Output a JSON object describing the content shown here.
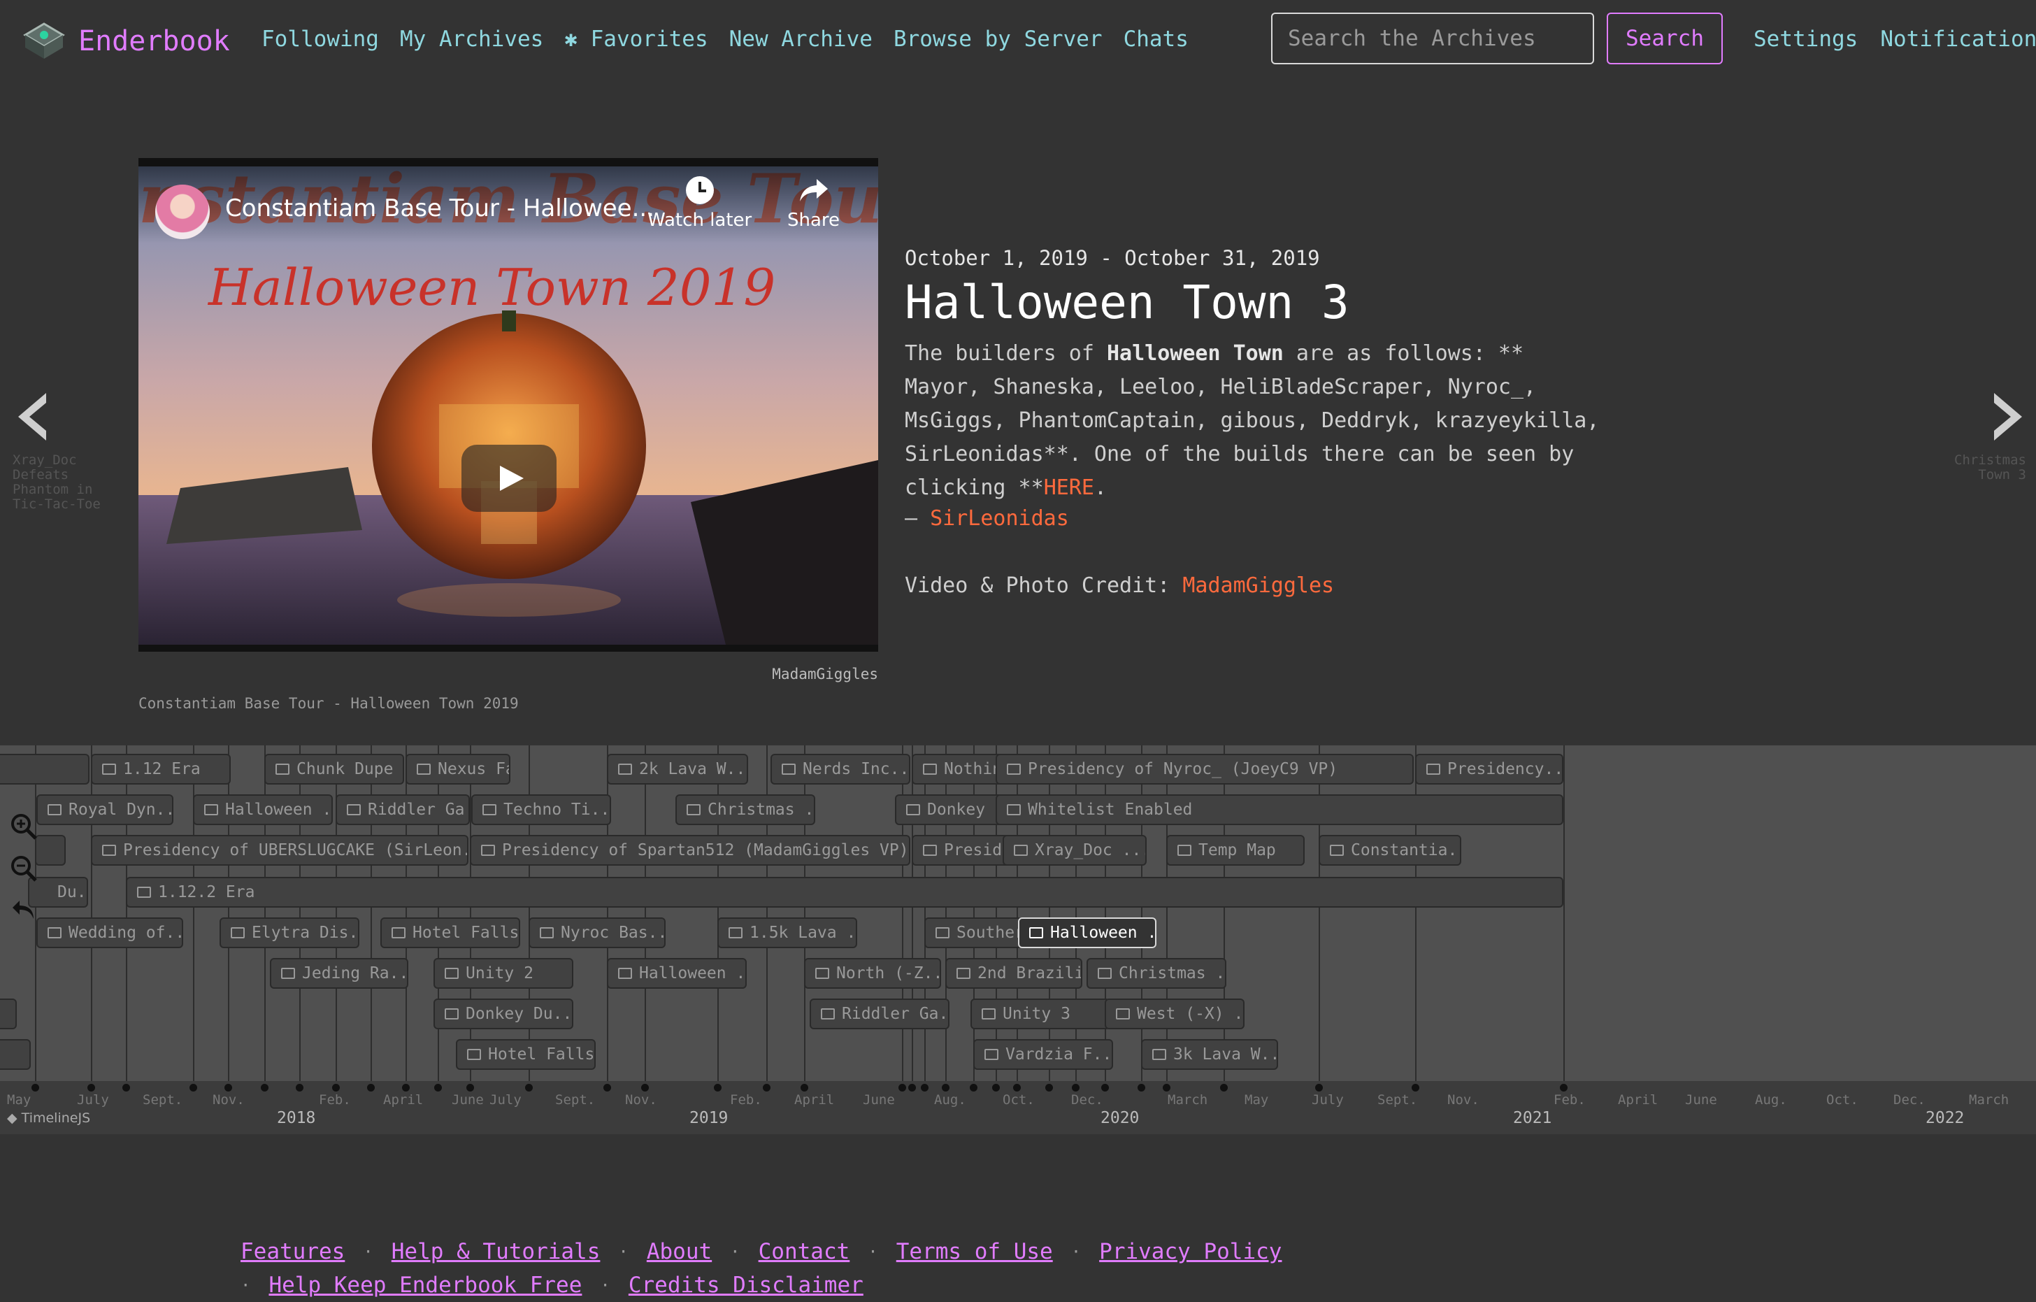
{
  "header": {
    "brand": "Enderbook",
    "nav": [
      "Following",
      "My Archives",
      "Favorites",
      "New Archive",
      "Browse by Server",
      "Chats"
    ],
    "search_placeholder": "Search the Archives",
    "search_button": "Search",
    "settings": "Settings",
    "notifications": "Notifications"
  },
  "slide": {
    "video_title": "Constantiam Base Tour - Hallowee...",
    "watch_later": "Watch later",
    "share": "Share",
    "video_credit": "MadamGiggles",
    "caption": "Constantiam Base Tour - Halloween Town 2019",
    "date": "October 1, 2019 - October 31, 2019",
    "title": "Halloween Town 3",
    "body_1": "The builders of ",
    "body_bold": "Halloween Town",
    "body_2": " are as follows: ** Mayor, Shaneska, Leeloo, HeliBladeScraper, Nyroc_, MsGiggs, PhantomCaptain, gibous, Deddryk, krazyeykilla, SirLeonidas**. One of the builds there can be seen by clicking **",
    "body_link": "HERE",
    "body_end": ".",
    "quote_dash": "— ",
    "quote_author": "SirLeonidas",
    "credit_label": "Video & Photo Credit: ",
    "credit_name": "MadamGiggles",
    "prev_label": "Xray_Doc Defeats Phantom in Tic-Tac-Toe",
    "next_label": "Christmas Town 3"
  },
  "timeline": {
    "events": [
      "1.12 Era",
      "Chunk Dupe",
      "Nexus Falls",
      "2k Lava W...",
      "Nerds Inc...",
      "Nothin",
      "Presidency of Nyroc_ (JoeyC9 VP)",
      "Presidency...",
      "Royal Dyn...",
      "Halloween ...",
      "Riddler Ga...",
      "Techno Ti...",
      "Christmas ...",
      "Donkey",
      "Whitelist Enabled",
      "Presidency of UBERSLUGCAKE (SirLeon...",
      "Presidency of Spartan512 (MadamGiggles VP)",
      "Preside",
      "Xray_Doc ...",
      "Temp Map",
      "Constantia...",
      "Du...",
      "1.12.2 Era",
      "Wedding of...",
      "Elytra Dis...",
      "Hotel Falls",
      "Nyroc Bas...",
      "1.5k Lava ...",
      "Souther",
      "Halloween ...",
      "Jeding Ra...",
      "Unity 2",
      "Halloween ...",
      "North (-Z...",
      "2nd Brazili...",
      "Christmas ...",
      "Donkey Du...",
      "Riddler Ga...",
      "Unity 3",
      "West (-X) ...",
      "Hotel Falls...",
      "Vardzia F...",
      "3k Lava W..."
    ],
    "months": [
      "May",
      "July",
      "Sept.",
      "Nov.",
      "Feb.",
      "April",
      "June",
      "July",
      "Sept.",
      "Nov.",
      "Feb.",
      "April",
      "June",
      "Aug.",
      "Oct.",
      "Dec.",
      "March",
      "May",
      "July",
      "Sept.",
      "Nov.",
      "Feb.",
      "April",
      "June",
      "Aug.",
      "Oct.",
      "Dec.",
      "March"
    ],
    "years": [
      "2018",
      "2019",
      "2020",
      "2021",
      "2022"
    ],
    "attribution": "TimelineJS"
  },
  "footer": {
    "row1": [
      "Features",
      "Help & Tutorials",
      "About",
      "Contact",
      "Terms of Use",
      "Privacy Policy"
    ],
    "row2": [
      "Help Keep Enderbook Free",
      "Credits Disclaimer"
    ]
  },
  "colors": {
    "accent": "#e17cff",
    "nav": "#8fd8e0",
    "link": "#ff6a3d",
    "background": "#333333"
  }
}
